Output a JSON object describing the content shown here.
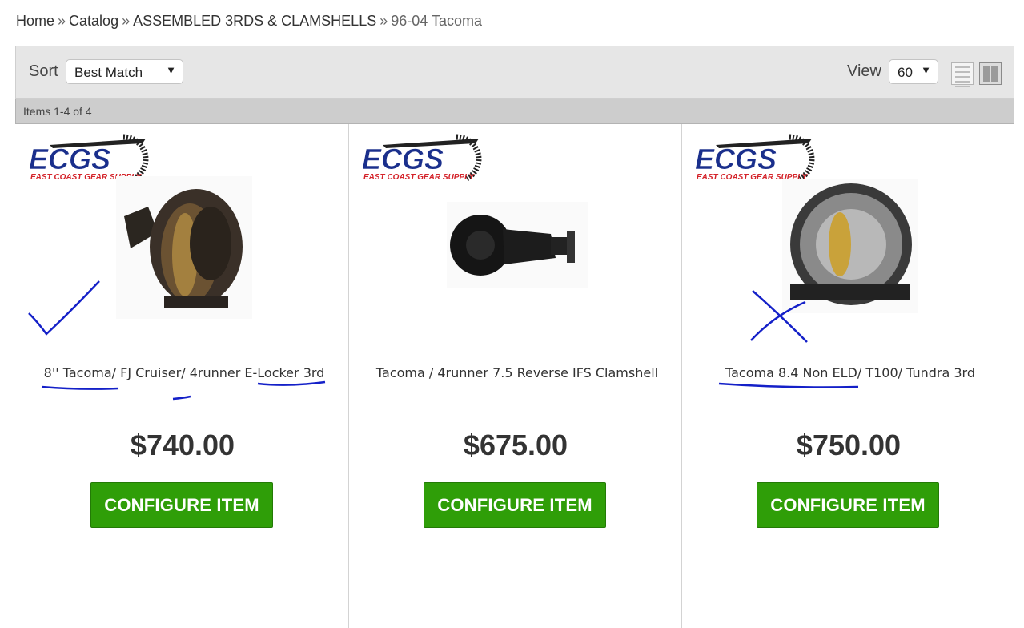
{
  "breadcrumb": {
    "home": "Home",
    "catalog": "Catalog",
    "category": "ASSEMBLED 3RDS & CLAMSHELLS",
    "current": "96-04 Tacoma",
    "separator": "»"
  },
  "toolbar": {
    "sort_label": "Sort",
    "sort_value": "Best Match",
    "view_label": "View",
    "view_value": "60",
    "dropdown_arrow": "▼"
  },
  "items_count": "Items 1-4 of 4",
  "brand": {
    "logo_text": "ECGS",
    "logo_subtext": "EAST COAST GEAR SUPPLY",
    "logo_blue": "#1a2f8c",
    "logo_red": "#d4232a"
  },
  "products": [
    {
      "title": "8'' Tacoma/ FJ Cruiser/ 4runner E-Locker 3rd",
      "price": "$740.00",
      "button": "CONFIGURE ITEM",
      "image_icon": "differential-3rd-member-icon"
    },
    {
      "title": "Tacoma / 4runner 7.5 Reverse IFS Clamshell",
      "price": "$675.00",
      "button": "CONFIGURE ITEM",
      "image_icon": "clamshell-differential-icon"
    },
    {
      "title": "Tacoma 8.4 Non ELD/ T100/ Tundra 3rd",
      "price": "$750.00",
      "button": "CONFIGURE ITEM",
      "image_icon": "differential-open-carrier-icon"
    }
  ],
  "colors": {
    "button_green": "#2f9e08",
    "annotation_ink": "#1420c8"
  }
}
